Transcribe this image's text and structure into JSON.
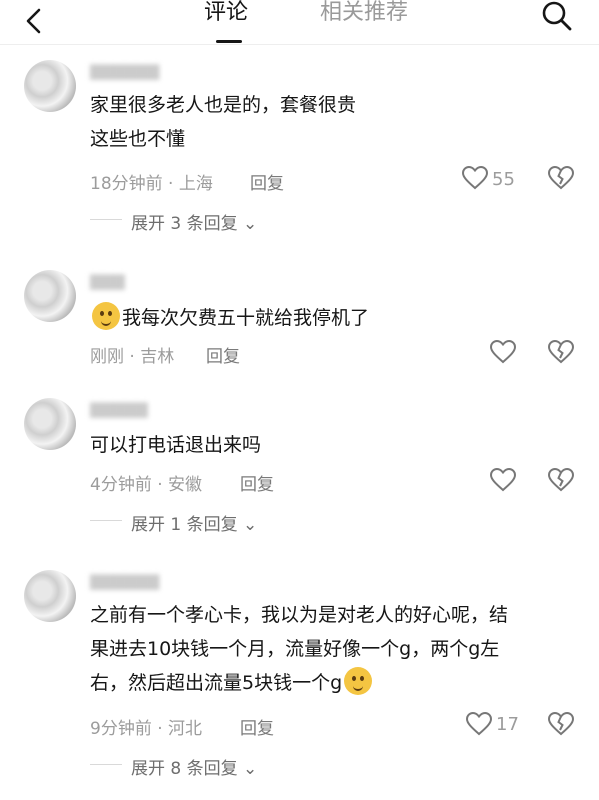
{
  "header": {
    "tabs": [
      {
        "label": "评论",
        "active": true
      },
      {
        "label": "相关推荐",
        "active": false
      }
    ]
  },
  "comments": [
    {
      "lines": [
        "家里很多老人也是的，套餐很贵",
        "这些也不懂"
      ],
      "time_location": "18分钟前 · 上海",
      "reply_label": "回复",
      "likes": "55",
      "expand_label": "展开 3 条回复"
    },
    {
      "emoji": "thinking-face",
      "lines": [
        "我每次欠费五十就给我停机了"
      ],
      "time_location": "刚刚 · 吉林",
      "reply_label": "回复",
      "likes": ""
    },
    {
      "lines": [
        "可以打电话退出来吗"
      ],
      "time_location": "4分钟前 · 安徽",
      "reply_label": "回复",
      "likes": "",
      "expand_label": "展开 1 条回复"
    },
    {
      "lines": [
        "之前有一个孝心卡，我以为是对老人的好心呢，结",
        "果进去10块钱一个月，流量好像一个g，两个g左",
        "右，然后超出流量5块钱一个g"
      ],
      "emoji_after": "grinning-sweat-face",
      "time_location": "9分钟前 · 河北",
      "reply_label": "回复",
      "likes": "17",
      "expand_label": "展开 8 条回复"
    }
  ],
  "colors": {
    "text": "#161616",
    "meta": "#9c9c9c",
    "emoji": "#f4c542"
  }
}
